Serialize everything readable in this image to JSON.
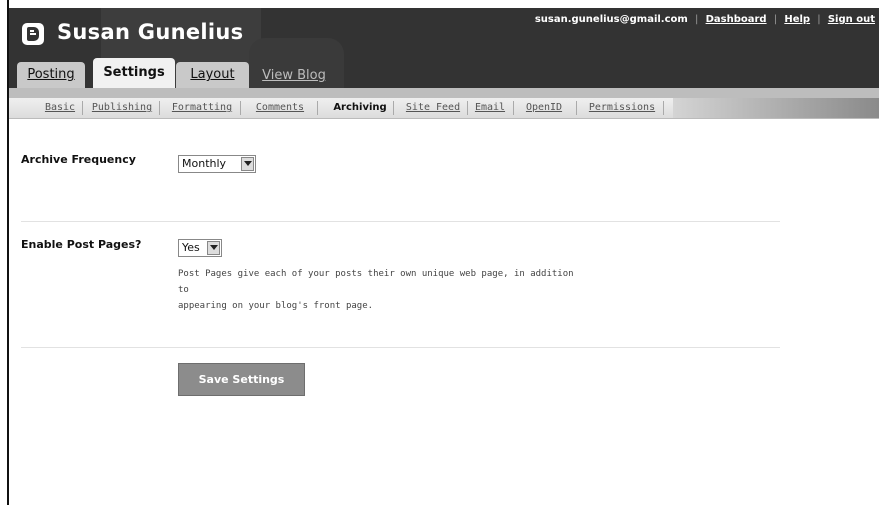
{
  "header": {
    "blog_title": "Susan Gunelius",
    "user_email": "susan.gunelius@gmail.com",
    "links": {
      "dashboard": "Dashboard",
      "help": "Help",
      "sign_out": "Sign out"
    },
    "separator": "|"
  },
  "tabs": {
    "posting": "Posting",
    "settings": "Settings",
    "layout": "Layout",
    "view_blog": "View Blog"
  },
  "subnav": {
    "basic": "Basic",
    "publishing": "Publishing",
    "formatting": "Formatting",
    "comments": "Comments",
    "archiving": "Archiving",
    "site_feed": "Site Feed",
    "email": "Email",
    "openid": "OpenID",
    "permissions": "Permissions"
  },
  "form": {
    "archive_frequency_label": "Archive Frequency",
    "archive_frequency_value": "Monthly",
    "enable_post_pages_label": "Enable Post Pages?",
    "enable_post_pages_value": "Yes",
    "post_pages_help_line1": "Post Pages give each of your posts their own unique web page, in addition to",
    "post_pages_help_line2": "appearing on your blog's front page.",
    "save_button": "Save Settings"
  }
}
